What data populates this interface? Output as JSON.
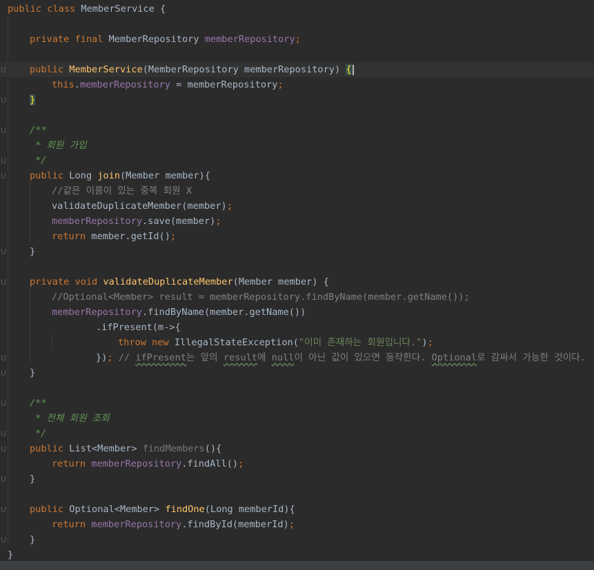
{
  "editor": {
    "lines": [
      {
        "indent": 0,
        "fold": false,
        "segments": [
          {
            "t": "public class ",
            "c": "kw"
          },
          {
            "t": "MemberService {",
            "c": ""
          }
        ]
      },
      {
        "indent": 0,
        "fold": false,
        "segments": []
      },
      {
        "indent": 4,
        "fold": false,
        "segments": [
          {
            "t": "private final ",
            "c": "kw"
          },
          {
            "t": "MemberRepository ",
            "c": ""
          },
          {
            "t": "memberRepository",
            "c": "fld"
          },
          {
            "t": ";",
            "c": "kw"
          }
        ]
      },
      {
        "indent": 0,
        "fold": false,
        "segments": []
      },
      {
        "indent": 4,
        "fold": true,
        "current": true,
        "segments": [
          {
            "t": "public ",
            "c": "kw"
          },
          {
            "t": "MemberService",
            "c": "fn"
          },
          {
            "t": "(MemberRepository memberRepository) ",
            "c": ""
          },
          {
            "t": "{",
            "c": "brace-hl"
          }
        ]
      },
      {
        "indent": 8,
        "fold": false,
        "segments": [
          {
            "t": "this",
            "c": "kw"
          },
          {
            "t": ".",
            "c": ""
          },
          {
            "t": "memberRepository",
            "c": "fld"
          },
          {
            "t": " = memberRepository",
            "c": ""
          },
          {
            "t": ";",
            "c": "kw"
          }
        ]
      },
      {
        "indent": 4,
        "fold": true,
        "segments": [
          {
            "t": "}",
            "c": "brace-hl"
          }
        ]
      },
      {
        "indent": 0,
        "fold": false,
        "segments": []
      },
      {
        "indent": 4,
        "fold": true,
        "segments": [
          {
            "t": "/**",
            "c": "doc"
          }
        ]
      },
      {
        "indent": 5,
        "fold": false,
        "segments": [
          {
            "t": "* 회원 가입",
            "c": "doc"
          }
        ]
      },
      {
        "indent": 5,
        "fold": true,
        "segments": [
          {
            "t": "*/",
            "c": "doc"
          }
        ]
      },
      {
        "indent": 4,
        "fold": true,
        "segments": [
          {
            "t": "public ",
            "c": "kw"
          },
          {
            "t": "Long ",
            "c": ""
          },
          {
            "t": "join",
            "c": "fn"
          },
          {
            "t": "(Member member){",
            "c": ""
          }
        ]
      },
      {
        "indent": 8,
        "fold": false,
        "segments": [
          {
            "t": "//같은 이름이 있는 중복 회원 X",
            "c": "cm"
          }
        ]
      },
      {
        "indent": 8,
        "fold": false,
        "segments": [
          {
            "t": "validateDuplicateMember(member)",
            "c": ""
          },
          {
            "t": ";",
            "c": "kw"
          }
        ]
      },
      {
        "indent": 8,
        "fold": false,
        "segments": [
          {
            "t": "memberRepository",
            "c": "fld"
          },
          {
            "t": ".save(member)",
            "c": ""
          },
          {
            "t": ";",
            "c": "kw"
          }
        ]
      },
      {
        "indent": 8,
        "fold": false,
        "segments": [
          {
            "t": "return ",
            "c": "kw"
          },
          {
            "t": "member.getId()",
            "c": ""
          },
          {
            "t": ";",
            "c": "kw"
          }
        ]
      },
      {
        "indent": 4,
        "fold": true,
        "segments": [
          {
            "t": "}",
            "c": ""
          }
        ]
      },
      {
        "indent": 0,
        "fold": false,
        "segments": []
      },
      {
        "indent": 4,
        "fold": true,
        "segments": [
          {
            "t": "private void ",
            "c": "kw"
          },
          {
            "t": "validateDuplicateMember",
            "c": "fn"
          },
          {
            "t": "(Member member) {",
            "c": ""
          }
        ]
      },
      {
        "indent": 8,
        "fold": false,
        "segments": [
          {
            "t": "//Optional<Member> result = memberRepository.findByName(member.getName());",
            "c": "cm"
          }
        ]
      },
      {
        "indent": 8,
        "fold": false,
        "segments": [
          {
            "t": "memberRepository",
            "c": "fld"
          },
          {
            "t": ".findByName(member.getName())",
            "c": ""
          }
        ]
      },
      {
        "indent": 16,
        "fold": false,
        "segments": [
          {
            "t": ".ifPresent(m->{",
            "c": ""
          }
        ]
      },
      {
        "indent": 20,
        "fold": false,
        "segments": [
          {
            "t": "throw new ",
            "c": "kw"
          },
          {
            "t": "IllegalStateException(",
            "c": ""
          },
          {
            "t": "\"이미 존재하는 회원입니다.\"",
            "c": "str"
          },
          {
            "t": ")",
            "c": ""
          },
          {
            "t": ";",
            "c": "kw"
          }
        ]
      },
      {
        "indent": 16,
        "fold": true,
        "segments": [
          {
            "t": "})",
            "c": ""
          },
          {
            "t": "; ",
            "c": "kw"
          },
          {
            "t": "// ",
            "c": "cm"
          },
          {
            "t": "ifPresent",
            "c": "cm sq"
          },
          {
            "t": "는 앞의 ",
            "c": "cm"
          },
          {
            "t": "result",
            "c": "cm sq"
          },
          {
            "t": "에 ",
            "c": "cm"
          },
          {
            "t": "null",
            "c": "cm sq"
          },
          {
            "t": "이 아닌 값이 있으면 동작한다. ",
            "c": "cm"
          },
          {
            "t": "Optional",
            "c": "cm sq"
          },
          {
            "t": "로 감싸서 가능한 것이다.",
            "c": "cm"
          }
        ]
      },
      {
        "indent": 4,
        "fold": true,
        "segments": [
          {
            "t": "}",
            "c": ""
          }
        ]
      },
      {
        "indent": 0,
        "fold": false,
        "segments": []
      },
      {
        "indent": 4,
        "fold": true,
        "segments": [
          {
            "t": "/**",
            "c": "doc"
          }
        ]
      },
      {
        "indent": 5,
        "fold": false,
        "segments": [
          {
            "t": "* 전체 회원 조회",
            "c": "doc"
          }
        ]
      },
      {
        "indent": 5,
        "fold": true,
        "segments": [
          {
            "t": "*/",
            "c": "doc"
          }
        ]
      },
      {
        "indent": 4,
        "fold": true,
        "segments": [
          {
            "t": "public ",
            "c": "kw"
          },
          {
            "t": "List<Member> ",
            "c": ""
          },
          {
            "t": "findMembers",
            "c": "dim"
          },
          {
            "t": "(){",
            "c": ""
          }
        ]
      },
      {
        "indent": 8,
        "fold": false,
        "segments": [
          {
            "t": "return ",
            "c": "kw"
          },
          {
            "t": "memberRepository",
            "c": "fld"
          },
          {
            "t": ".findAll()",
            "c": ""
          },
          {
            "t": ";",
            "c": "kw"
          }
        ]
      },
      {
        "indent": 4,
        "fold": true,
        "segments": [
          {
            "t": "}",
            "c": ""
          }
        ]
      },
      {
        "indent": 0,
        "fold": false,
        "segments": []
      },
      {
        "indent": 4,
        "fold": true,
        "segments": [
          {
            "t": "public ",
            "c": "kw"
          },
          {
            "t": "Optional<Member> ",
            "c": ""
          },
          {
            "t": "findOne",
            "c": "fn"
          },
          {
            "t": "(Long memberId){",
            "c": ""
          }
        ]
      },
      {
        "indent": 8,
        "fold": false,
        "segments": [
          {
            "t": "return ",
            "c": "kw"
          },
          {
            "t": "memberRepository",
            "c": "fld"
          },
          {
            "t": ".findById(memberId)",
            "c": ""
          },
          {
            "t": ";",
            "c": "kw"
          }
        ]
      },
      {
        "indent": 4,
        "fold": true,
        "segments": [
          {
            "t": "}",
            "c": ""
          }
        ]
      },
      {
        "indent": 0,
        "fold": false,
        "segments": [
          {
            "t": "}",
            "c": ""
          }
        ]
      }
    ]
  }
}
